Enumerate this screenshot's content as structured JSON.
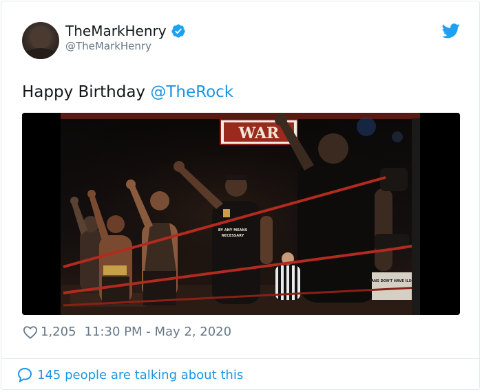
{
  "tweet": {
    "author": {
      "display_name": "TheMarkHenry",
      "handle": "@TheMarkHenry",
      "verified": true
    },
    "text_prefix": "Happy Birthday ",
    "mention": "@TheRock",
    "media": {
      "banner_text": "WAR",
      "shirt_text_1": "BY ANY MEANS",
      "shirt_text_2": "NECESSARY",
      "sign_text": "FANS DON'T HAVE ILSON"
    },
    "likes": "1,205",
    "timestamp": "11:30 PM - May 2, 2020",
    "conversation_text": "145 people are talking about this",
    "icons": {
      "platform": "twitter-bird-icon",
      "verified": "verified-badge-icon",
      "like": "heart-icon",
      "reply": "speech-bubble-icon"
    },
    "colors": {
      "accent": "#1b95e0",
      "verified": "#1da1f2",
      "muted": "#657786",
      "text": "#14171a",
      "border": "#e1e8ed"
    }
  }
}
